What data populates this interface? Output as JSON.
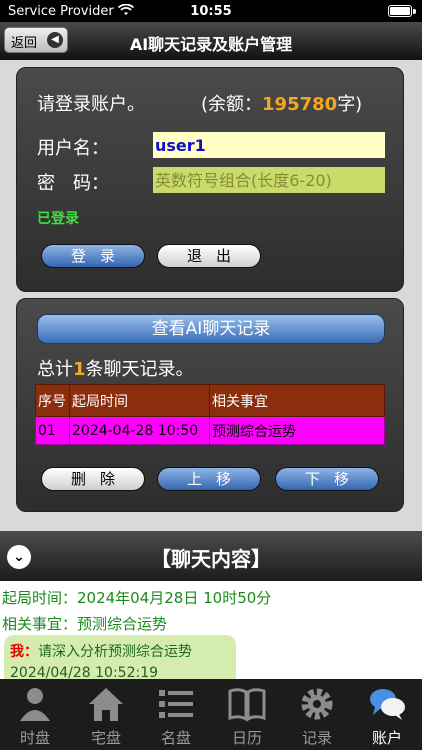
{
  "status_bar": {
    "carrier": "Service Provider",
    "time": "10:55"
  },
  "nav": {
    "back_label": "返回",
    "title": "AI聊天记录及账户管理"
  },
  "login": {
    "prompt": "请登录账户。",
    "balance_prefix": "(余额：",
    "balance_value": "195780",
    "balance_suffix": "字)",
    "username_label": "用户名：",
    "username_value": "user1",
    "password_label": "密　码：",
    "password_placeholder": "英数符号组合(长度6-20)",
    "status": "已登录",
    "login_button": "登录",
    "logout_button": "退出"
  },
  "records": {
    "view_button": "查看AI聊天记录",
    "total_prefix": "总计",
    "total_count": "1",
    "total_suffix": "条聊天记录。",
    "columns": [
      "序号",
      "起局时间",
      "相关事宜"
    ],
    "rows": [
      [
        "01",
        "2024-04-28 10:50",
        "预测综合运势"
      ]
    ],
    "delete_button": "删除",
    "up_button": "上移",
    "down_button": "下移"
  },
  "chat": {
    "header": "【聊天内容】",
    "start_time": "起局时间：2024年04月28日 10时50分",
    "matter": "相关事宜：预测综合运势",
    "me_label": "我：",
    "message": "请深入分析预测综合运势",
    "timestamp": "2024/04/28 10:52:19"
  },
  "tabs": [
    {
      "label": "时盘",
      "icon": "person-icon"
    },
    {
      "label": "宅盘",
      "icon": "house-icon"
    },
    {
      "label": "名盘",
      "icon": "list-icon"
    },
    {
      "label": "日历",
      "icon": "book-icon"
    },
    {
      "label": "记录",
      "icon": "gear-icon"
    },
    {
      "label": "账户",
      "icon": "chat-bubbles-icon"
    }
  ],
  "colors": {
    "accent_orange": "#f5a623",
    "record_row": "#ff00ff",
    "header_row": "#8a2e0e",
    "logged_green": "#3ee03e"
  }
}
